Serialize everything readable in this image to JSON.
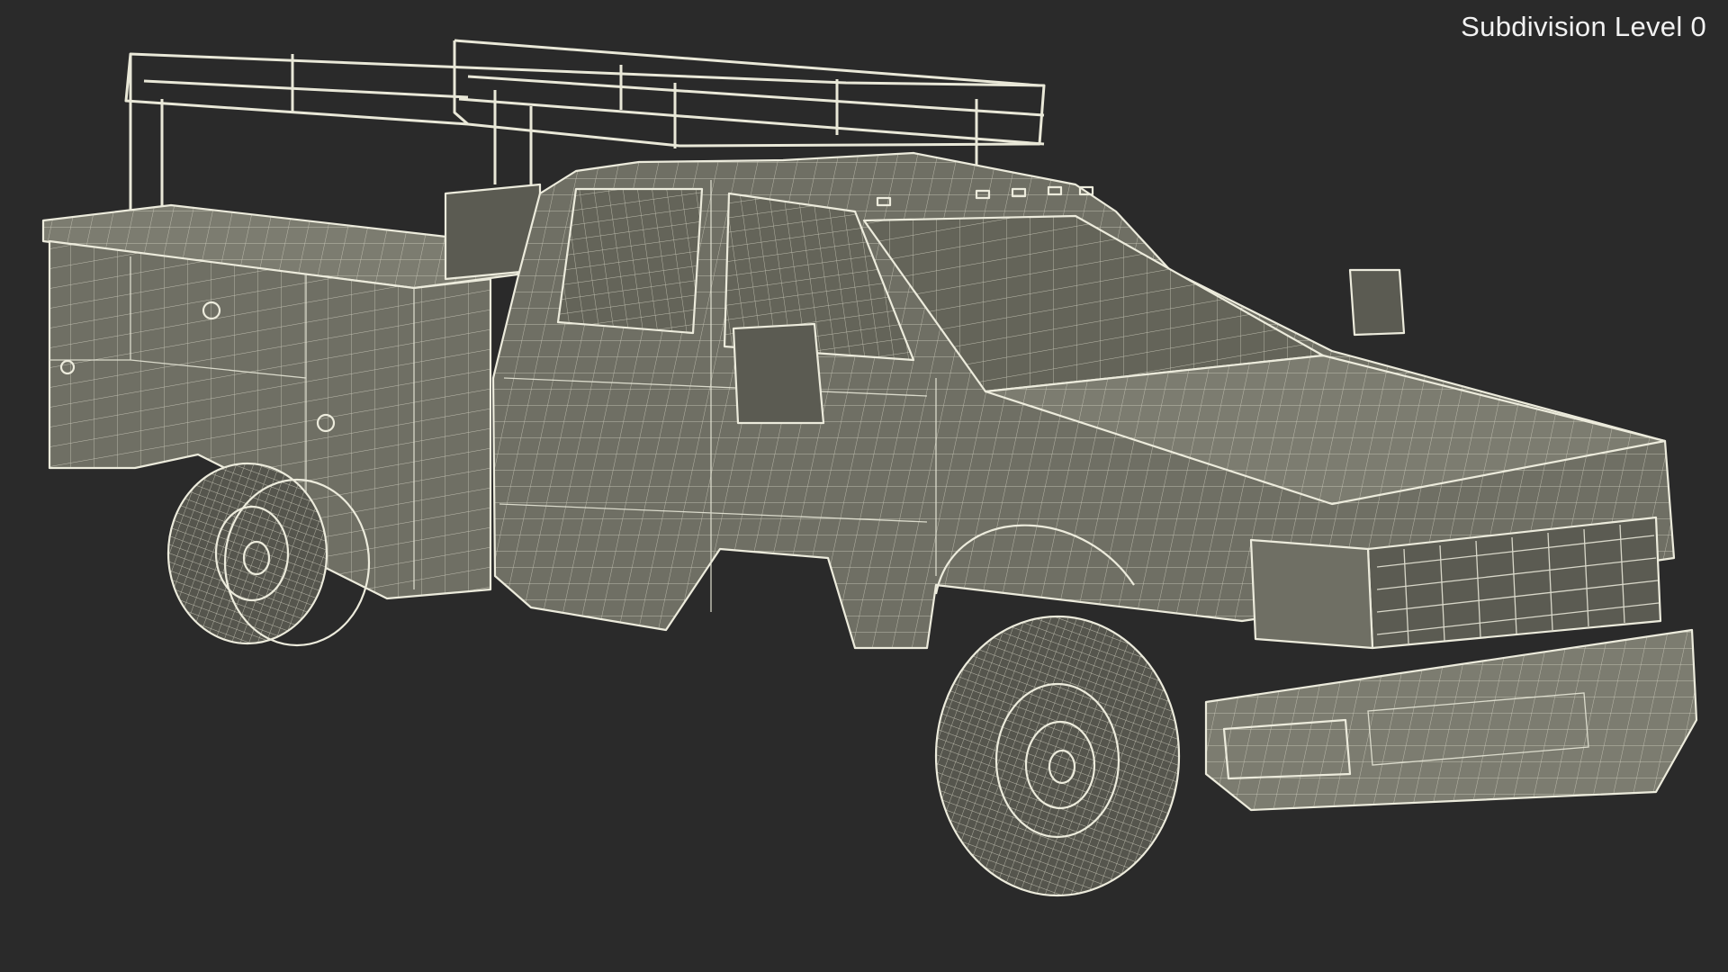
{
  "viewport": {
    "background_color": "#2a2a2a",
    "label": "Subdivision Level 0"
  },
  "model": {
    "render_style": "wireframe-on-shaded",
    "shade_color": "#6f6f64",
    "wire_color": "#ecebdc"
  }
}
